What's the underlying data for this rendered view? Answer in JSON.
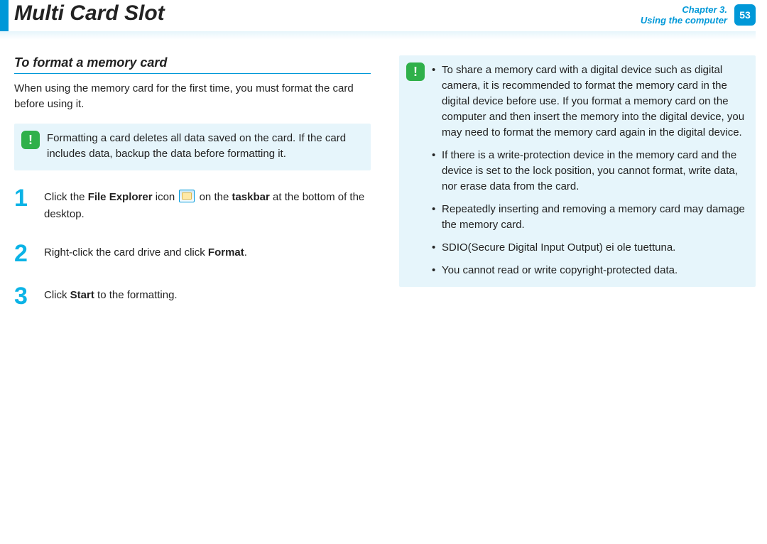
{
  "header": {
    "title": "Multi Card Slot",
    "chapter_line1": "Chapter 3.",
    "chapter_line2": "Using the computer",
    "page_number": "53"
  },
  "left": {
    "section_title": "To format a memory card",
    "intro": "When using the memory card for the first time, you must format the card before using it.",
    "warning": "Formatting a card deletes all data saved on the card. If the card includes data, backup the data before formatting it.",
    "steps": {
      "s1": {
        "num": "1",
        "pre": "Click the ",
        "b1": "File Explorer",
        "mid": " icon ",
        "post1": " on the ",
        "b2": "taskbar",
        "post2": " at the bottom of the desktop."
      },
      "s2": {
        "num": "2",
        "pre": "Right-click the card drive and click ",
        "b1": "Format",
        "post": "."
      },
      "s3": {
        "num": "3",
        "pre": "Click ",
        "b1": "Start",
        "post": " to the formatting."
      }
    }
  },
  "right": {
    "items": {
      "i0": "To share a memory card with a digital device such as digital camera, it is recommended to format the memory card in the digital device before use. If you format a memory card on the computer and then insert the memory into the digital device, you may need to format the memory card again in the digital device.",
      "i1": "If there is a write-protection device in the memory card and the device is set to the lock position, you cannot format, write data, nor erase data from the card.",
      "i2": "Repeatedly inserting and removing a memory card may damage the memory card.",
      "i3": "SDIO(Secure Digital Input Output) ei ole tuettuna.",
      "i4": "You cannot read or write copyright-protected data."
    }
  }
}
